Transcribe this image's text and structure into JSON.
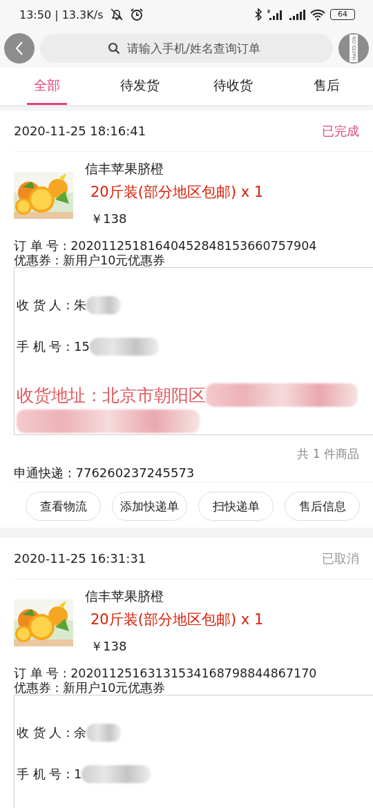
{
  "status_bar": {
    "time": "13:50 | 13.3K/s",
    "battery": "64"
  },
  "header": {
    "search": {
      "placeholder": "请输入手机/姓名查询订单"
    },
    "side_glyph": "NO GLYPH"
  },
  "tabs": [
    {
      "label": "全部",
      "selected": true
    },
    {
      "label": "待发货",
      "selected": false
    },
    {
      "label": "待收货",
      "selected": false
    },
    {
      "label": "售后",
      "selected": false
    }
  ],
  "orders": [
    {
      "time": "2020-11-25 18:16:41",
      "status": {
        "text": "已完成",
        "color": "#d9467a"
      },
      "product": {
        "kind": "picture",
        "name": "信丰苹果脐橙",
        "spec": "20斤装(部分地区包邮) x 1",
        "price": "￥138"
      },
      "order_no": "订 单 号 : 20201125181640452848153660757904",
      "coupon": "优惠券 : 新用户10元优惠券",
      "receiver": {
        "text": "收 货 人 : 朱",
        "redacted": true
      },
      "phone": {
        "text": "手 机 号 : 15",
        "redacted": true
      },
      "address": {
        "text": "收货地址 : 北京市朝阳区",
        "redacted": true
      },
      "total": "共 1 件商品",
      "courier": "申通快递 : 776260237245573",
      "buttons": [
        "查看物流",
        "添加快递单",
        "扫快递单",
        "售后信息"
      ]
    },
    {
      "time": "2020-11-25 16:31:31",
      "status": {
        "text": "已取消",
        "color": "#999999"
      },
      "product": {
        "kind": "picture",
        "name": "信丰苹果脐橙",
        "spec": "20斤装(部分地区包邮) x 1",
        "price": "￥138"
      },
      "order_no": "订 单 号 : 20201125163131534168798844867170",
      "coupon": "优惠券 : 新用户10元优惠券",
      "receiver": {
        "text": "收 货 人 : 余",
        "redacted": true
      },
      "phone": {
        "text": "手 机 号 : 1",
        "redacted": true
      }
    }
  ]
}
